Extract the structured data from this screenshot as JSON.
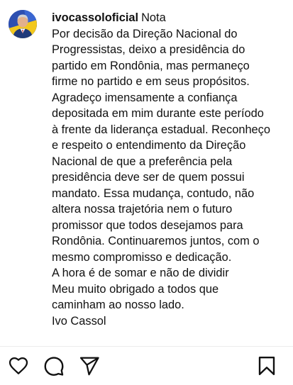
{
  "post": {
    "username": "ivocassoloficial",
    "label": "Nota",
    "caption": "Por decisão da Direção Nacional do Progressistas, deixo a presidência do partido em Rondônia, mas permaneço firme no partido e em seus propósitos. Agradeço imensamente a confiança depositada em mim durante este período à frente da liderança estadual. Reconheço e respeito o entendimento da Direção Nacional de que a preferência pela presidência deve ser de quem possui mandato. Essa mudança, contudo, não altera nossa trajetória nem o futuro promissor que todos desejamos para Rondônia. Continuaremos juntos, com o mesmo compromisso e dedicação.\nA hora é de somar e não de dividir\nMeu muito obrigado a todos que caminham ao nosso lado.\nIvo Cassol"
  },
  "actions": {
    "like_icon": "heart-outline-icon",
    "comment_icon": "speech-bubble-icon",
    "share_icon": "paper-plane-icon",
    "save_icon": "bookmark-icon"
  },
  "colors": {
    "text": "#111111",
    "avatar_blue": "#2d4fb0",
    "avatar_yellow": "#f2c81e",
    "divider": "#ececec"
  }
}
